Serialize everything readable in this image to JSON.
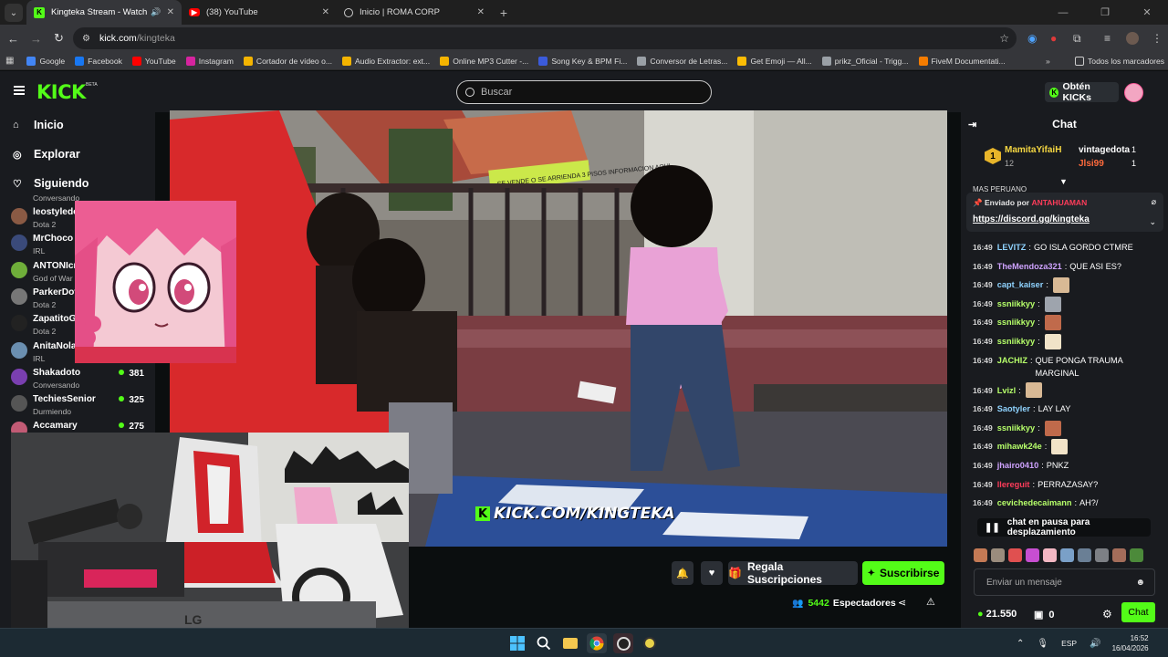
{
  "browser": {
    "tabs": [
      {
        "title": "Kingteka Stream - Watch Li",
        "icon": "kick-icon",
        "active": true,
        "audio": true
      },
      {
        "title": "(38) YouTube",
        "icon": "youtube-icon",
        "active": false
      },
      {
        "title": "Inicio | ROMA CORP",
        "icon": "globe-icon",
        "active": false
      }
    ],
    "url_host": "kick.com",
    "url_path": "/kingteka",
    "bookmarks": [
      {
        "label": "Google",
        "color": "#4285f4"
      },
      {
        "label": "Facebook",
        "color": "#1877f2"
      },
      {
        "label": "YouTube",
        "color": "#ff0000"
      },
      {
        "label": "Instagram",
        "color": "#d6249f"
      },
      {
        "label": "Cortador de vídeo o...",
        "color": "#f4b400"
      },
      {
        "label": "Audio Extractor: ext...",
        "color": "#f4b400"
      },
      {
        "label": "Online MP3 Cutter -...",
        "color": "#f4b400"
      },
      {
        "label": "Song Key & BPM Fi...",
        "color": "#3b5bdb"
      },
      {
        "label": "Conversor de Letras...",
        "color": "#9aa0a6"
      },
      {
        "label": "Get Emoji — All...",
        "color": "#fbbc04"
      },
      {
        "label": "prikz_Oficial - Trigg...",
        "color": "#9aa0a6"
      },
      {
        "label": "FiveM Documentati...",
        "color": "#f57c00"
      }
    ],
    "all_bookmarks": "Todos los marcadores"
  },
  "site": {
    "logo": "KICK",
    "beta": "BETA",
    "search_placeholder": "Buscar",
    "get_kicks": "Obtén KICKs",
    "accent": "#53fc18"
  },
  "sidebar": {
    "nav": [
      {
        "label": "Inicio",
        "icon": "home-icon"
      },
      {
        "label": "Explorar",
        "icon": "compass-icon"
      },
      {
        "label": "Siguiendo",
        "icon": "heart-icon"
      }
    ],
    "channels_top_cut": "Conversando",
    "channels": [
      {
        "name": "leostyledo",
        "game": "Dota 2",
        "viewers": "",
        "color": "#8a5a44"
      },
      {
        "name": "MrChoco",
        "game": "IRL",
        "viewers": "",
        "color": "#3a4a7a"
      },
      {
        "name": "ANTONIcr",
        "game": "God of War",
        "viewers": "",
        "color": "#6fae3a"
      },
      {
        "name": "ParkerDot",
        "game": "Dota 2",
        "viewers": "",
        "color": "#777"
      },
      {
        "name": "ZapatitoG",
        "game": "Dota 2",
        "viewers": "",
        "color": "#222"
      },
      {
        "name": "AnitaNola",
        "game": "IRL",
        "viewers": "",
        "color": "#6b8fb0"
      },
      {
        "name": "Shakadoto",
        "game": "Conversando",
        "viewers": "381",
        "color": "#7a3fb0"
      },
      {
        "name": "TechiesSenior",
        "game": "Durmiendo",
        "viewers": "325",
        "color": "#555"
      },
      {
        "name": "Accamary",
        "game": "",
        "viewers": "275",
        "color": "#c25b75"
      }
    ]
  },
  "video": {
    "watermark": "KICK.COM/KINGTEKA",
    "sign_text": "SE VENDE O SE ARRIENDA 3 PISOS INFORMACION AQUI"
  },
  "actions": {
    "gift": "Regala Suscripciones",
    "subscribe": "Suscribirse",
    "viewers_count": "5442",
    "viewers_label": "Espectadores"
  },
  "chat": {
    "title": "Chat",
    "leaderboard": [
      {
        "rank": "1",
        "name": "MamitaYifaiH",
        "count": "12",
        "color": "#f5d742"
      },
      {
        "name": "vintagedota",
        "count": "1",
        "color": "#fff"
      },
      {
        "name": "Jlsi99",
        "count": "1",
        "color": "#ff6a3c"
      }
    ],
    "cut_text": "MAS PERUANO",
    "pinned_by_label": "Enviado por",
    "pinned_by": "ANTAHUAMAN",
    "pinned_link": "https://discord.gg/kingteka",
    "messages": [
      {
        "time": "16:49",
        "user": "LEVITZ",
        "color": "#8fd3ff",
        "text": "GO ISLA GORDO CTMRE"
      },
      {
        "time": "16:49",
        "user": "TheMendoza321",
        "color": "#cfa3ff",
        "text": "QUE ASI ES?"
      },
      {
        "time": "16:49",
        "user": "capt_kaiser",
        "color": "#8fd3ff",
        "text": ""
      },
      {
        "time": "16:49",
        "user": "ssniikkyy",
        "color": "#b6ff6a",
        "text": ""
      },
      {
        "time": "16:49",
        "user": "ssniikkyy",
        "color": "#b6ff6a",
        "text": ""
      },
      {
        "time": "16:49",
        "user": "ssniikkyy",
        "color": "#b6ff6a",
        "text": ""
      },
      {
        "time": "16:49",
        "user": "JACHIZ",
        "color": "#b6ff6a",
        "text": "QUE PONGA TRAUMA MARGINAL"
      },
      {
        "time": "16:49",
        "user": "Lvizl",
        "color": "#b6ff6a",
        "text": ""
      },
      {
        "time": "16:49",
        "user": "Saotyler",
        "color": "#8fd3ff",
        "text": "LAY LAY"
      },
      {
        "time": "16:49",
        "user": "ssniikkyy",
        "color": "#b6ff6a",
        "text": ""
      },
      {
        "time": "16:49",
        "user": "mihawk24e",
        "color": "#b6ff6a",
        "text": ""
      },
      {
        "time": "16:49",
        "user": "jhairo0410",
        "color": "#cfa3ff",
        "text": "PNKZ"
      },
      {
        "time": "16:49",
        "user": "llereguit",
        "color": "#ff3c5a",
        "text": "PERRAZASAY?"
      },
      {
        "time": "16:49",
        "user": "cevichedecaimann",
        "color": "#b6ff6a",
        "text": "AH?/"
      }
    ],
    "paused": "chat en pausa para desplazamiento",
    "input_placeholder": "Enviar un mensaje",
    "kicks": "21.550",
    "points": "0",
    "send": "Chat"
  },
  "taskbar": {
    "lang": "ESP",
    "time": "16:52",
    "date": "16/04/2026"
  }
}
